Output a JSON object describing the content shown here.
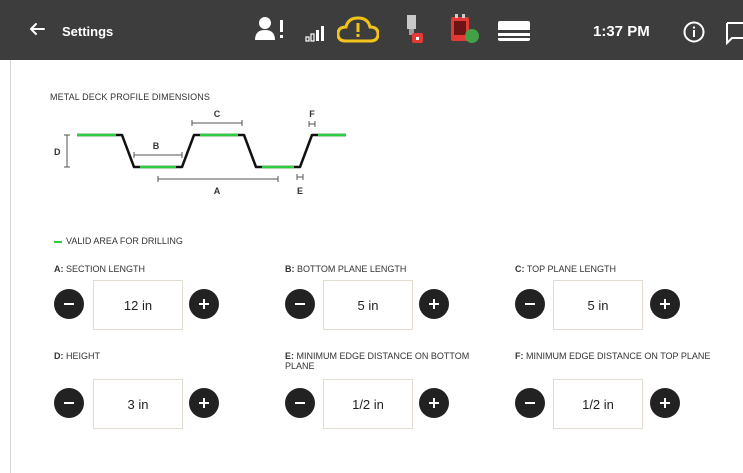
{
  "header": {
    "title": "Settings",
    "time": "1:37 PM"
  },
  "profile": {
    "section_title": "METAL DECK PROFILE DIMENSIONS",
    "diagram_labels": {
      "a": "A",
      "b": "B",
      "c": "C",
      "d": "D",
      "e": "E",
      "f": "F"
    },
    "legend": "VALID AREA FOR DRILLING"
  },
  "fields": [
    {
      "key": "A",
      "label": "SECTION LENGTH",
      "value": "12 in"
    },
    {
      "key": "B",
      "label": "BOTTOM PLANE LENGTH",
      "value": "5 in"
    },
    {
      "key": "C",
      "label": "TOP PLANE LENGTH",
      "value": "5 in"
    },
    {
      "key": "D",
      "label": "HEIGHT",
      "value": "3 in"
    },
    {
      "key": "E",
      "label": "MINIMUM EDGE DISTANCE ON BOTTOM PLANE",
      "value": "1/2 in"
    },
    {
      "key": "F",
      "label": "MINIMUM EDGE DISTANCE ON TOP PLANE",
      "value": "1/2 in"
    }
  ],
  "colors": {
    "topbar": "#3d3d3d",
    "drill_area": "#2ecc40",
    "cloud": "#f2c318",
    "alert_red": "#e53935",
    "ok_green": "#43a047"
  },
  "icons": [
    "back-arrow-icon",
    "user-alert-icon",
    "signal-icon",
    "cloud-icon",
    "tool-lock-icon",
    "battery-status-icon",
    "printer-icon",
    "info-icon",
    "chat-icon",
    "minus-icon",
    "plus-icon"
  ]
}
